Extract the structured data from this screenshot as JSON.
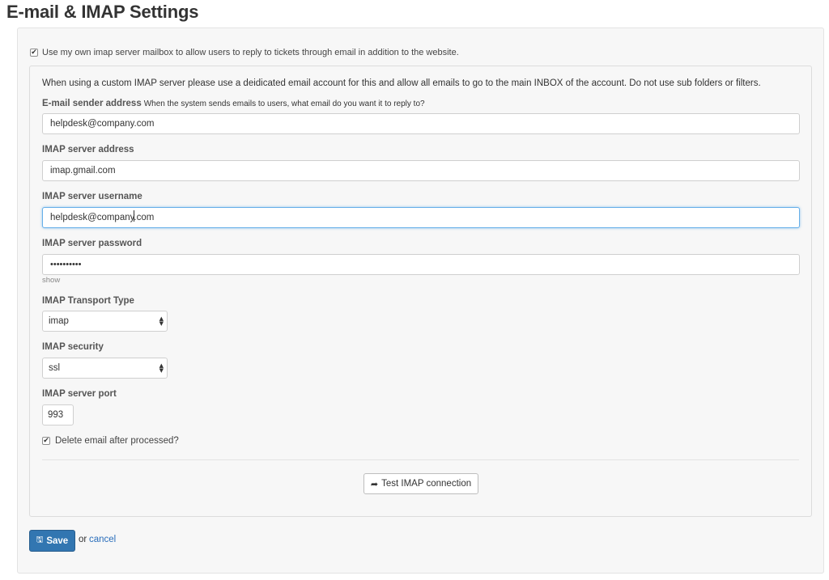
{
  "page": {
    "title": "E-mail & IMAP Settings"
  },
  "own_server": {
    "checked": "✔",
    "label": "Use my own imap server mailbox to allow users to reply to tickets through email in addition to the website."
  },
  "form": {
    "note": "When using a custom IMAP server please use a deidicated email account for this and allow all emails to go to the main INBOX of the account. Do not use sub folders or filters.",
    "sender": {
      "label": "E-mail sender address",
      "hint": "When the system sends emails to users, what email do you want it to reply to?",
      "value": "helpdesk@company.com"
    },
    "server_address": {
      "label": "IMAP server address",
      "value": "imap.gmail.com"
    },
    "username": {
      "label": "IMAP server username",
      "value_before_caret": "helpdesk@company",
      "value_after_caret": ".com"
    },
    "password": {
      "label": "IMAP server password",
      "masked_value": "••••••••••",
      "show_link": "show"
    },
    "transport": {
      "label": "IMAP Transport Type",
      "selected": "imap"
    },
    "security": {
      "label": "IMAP security",
      "selected": "ssl"
    },
    "port": {
      "label": "IMAP server port",
      "value": "993"
    },
    "delete_after": {
      "checked": "✔",
      "label": "Delete email after processed?"
    },
    "test_button": {
      "icon": "share-arrow-icon",
      "label": "Test IMAP connection"
    }
  },
  "actions": {
    "save_label": "Save",
    "save_icon": "floppy-disk-icon",
    "or_text": "or",
    "cancel_label": "cancel"
  },
  "colors": {
    "primary": "#3276b1",
    "link": "#2a6ebb",
    "focus_border": "#66afe9",
    "panel_background": "#f7f7f7"
  }
}
